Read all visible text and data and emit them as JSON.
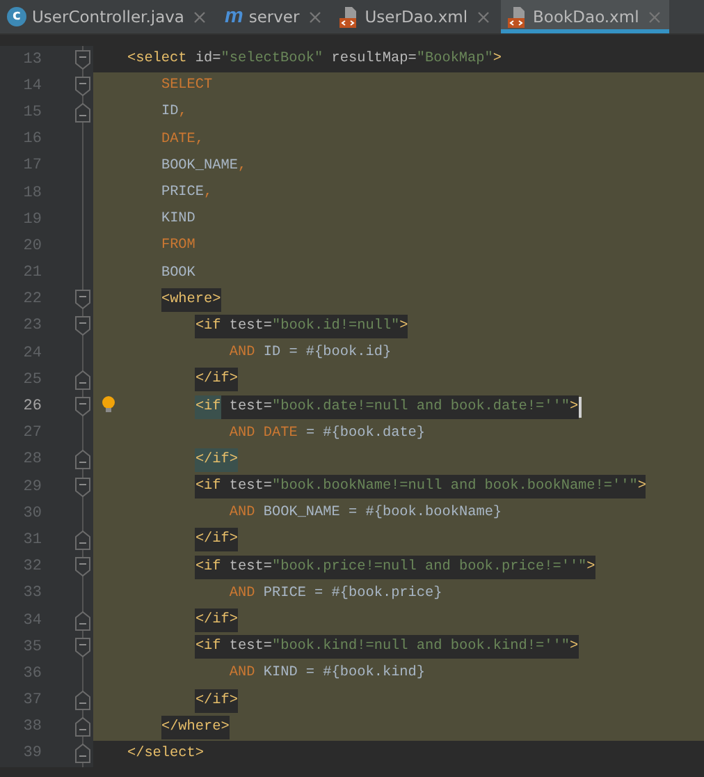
{
  "tabs": [
    {
      "label": "UserController.java",
      "kind": "class",
      "icon_text": "c",
      "selected": false
    },
    {
      "label": "server",
      "kind": "maven",
      "icon_text": "m",
      "selected": false
    },
    {
      "label": "UserDao.xml",
      "kind": "xml",
      "selected": false
    },
    {
      "label": "BookDao.xml",
      "kind": "xml",
      "selected": true
    }
  ],
  "editor": {
    "lines": [
      {
        "number": "13",
        "current": false,
        "hint": false,
        "sql": false,
        "fold_start": true,
        "fold_end": false,
        "tokens": [
          {
            "kind": "tag",
            "text": "<select",
            "matched": false
          },
          {
            "kind": "attr",
            "text": " id=",
            "matched": false
          },
          {
            "kind": "str",
            "text": "\"selectBook\"",
            "matched": false
          },
          {
            "kind": "attr",
            "text": " resultMap=",
            "matched": false
          },
          {
            "kind": "str",
            "text": "\"BookMap\"",
            "matched": false
          },
          {
            "kind": "tag",
            "text": ">",
            "matched": false
          }
        ],
        "children": [
          {
            "number": "14",
            "current": false,
            "hint": false,
            "sql": true,
            "fold_start": true,
            "fold_end": false,
            "tokens": [
              {
                "kind": "kw",
                "text": "SELECT",
                "matched": false
              }
            ]
          },
          {
            "number": "15",
            "current": false,
            "hint": false,
            "sql": true,
            "fold_start": false,
            "fold_end": true,
            "tokens": [
              {
                "kind": "text",
                "text": "ID",
                "matched": false
              },
              {
                "kind": "kw",
                "text": ",",
                "matched": false
              }
            ]
          },
          {
            "number": "16",
            "current": false,
            "hint": false,
            "sql": true,
            "fold_start": false,
            "fold_end": false,
            "tokens": [
              {
                "kind": "kw",
                "text": "DATE,",
                "matched": false
              }
            ]
          },
          {
            "number": "17",
            "current": false,
            "hint": false,
            "sql": true,
            "fold_start": false,
            "fold_end": false,
            "tokens": [
              {
                "kind": "text",
                "text": "BOOK_NAME",
                "matched": false
              },
              {
                "kind": "kw",
                "text": ",",
                "matched": false
              }
            ]
          },
          {
            "number": "18",
            "current": false,
            "hint": false,
            "sql": true,
            "fold_start": false,
            "fold_end": false,
            "tokens": [
              {
                "kind": "text",
                "text": "PRICE",
                "matched": false
              },
              {
                "kind": "kw",
                "text": ",",
                "matched": false
              }
            ]
          },
          {
            "number": "19",
            "current": false,
            "hint": false,
            "sql": true,
            "fold_start": false,
            "fold_end": false,
            "tokens": [
              {
                "kind": "text",
                "text": "KIND",
                "matched": false
              }
            ]
          },
          {
            "number": "20",
            "current": false,
            "hint": false,
            "sql": true,
            "fold_start": false,
            "fold_end": false,
            "tokens": [
              {
                "kind": "kw",
                "text": "FROM",
                "matched": false
              }
            ]
          },
          {
            "number": "21",
            "current": false,
            "hint": false,
            "sql": true,
            "fold_start": false,
            "fold_end": false,
            "tokens": [
              {
                "kind": "text",
                "text": "BOOK",
                "matched": false
              }
            ]
          },
          {
            "number": "22",
            "current": false,
            "hint": false,
            "sql": true,
            "fold_start": true,
            "fold_end": false,
            "tokens": [
              {
                "kind": "tag",
                "text": "<where>",
                "matched": false
              }
            ],
            "children": [
              {
                "number": "23",
                "current": false,
                "hint": false,
                "sql": true,
                "fold_start": true,
                "fold_end": false,
                "tokens": [
                  {
                    "kind": "tag",
                    "text": "<if",
                    "matched": false
                  },
                  {
                    "kind": "attr",
                    "text": " test=",
                    "matched": false
                  },
                  {
                    "kind": "str",
                    "text": "\"book.id!=null\"",
                    "matched": false
                  },
                  {
                    "kind": "tag",
                    "text": ">",
                    "matched": false
                  }
                ],
                "children": [
                  {
                    "number": "24",
                    "current": false,
                    "hint": false,
                    "sql": true,
                    "fold_start": false,
                    "fold_end": false,
                    "tokens": [
                      {
                        "kind": "kw",
                        "text": "AND",
                        "matched": false
                      },
                      {
                        "kind": "text",
                        "text": " ID = #{book.id}",
                        "matched": false
                      }
                    ]
                  }
                ]
              },
              {
                "number": "25",
                "current": false,
                "hint": false,
                "sql": true,
                "fold_start": false,
                "fold_end": true,
                "tokens": [
                  {
                    "kind": "tag",
                    "text": "</if>",
                    "matched": false
                  }
                ]
              },
              {
                "number": "26",
                "current": true,
                "hint": true,
                "sql": true,
                "fold_start": true,
                "fold_end": false,
                "tokens": [
                  {
                    "kind": "tag",
                    "text": "<if",
                    "matched": true
                  },
                  {
                    "kind": "attr",
                    "text": " test=",
                    "matched": false
                  },
                  {
                    "kind": "str",
                    "text": "\"book.date!=null and book.date!=''\"",
                    "matched": false
                  },
                  {
                    "kind": "tag",
                    "text": ">",
                    "matched": false
                  }
                ],
                "children": [
                  {
                    "number": "27",
                    "current": false,
                    "hint": false,
                    "sql": true,
                    "fold_start": false,
                    "fold_end": false,
                    "tokens": [
                      {
                        "kind": "kw",
                        "text": "AND DATE",
                        "matched": false
                      },
                      {
                        "kind": "text",
                        "text": " = #{book.date}",
                        "matched": false
                      }
                    ]
                  }
                ]
              },
              {
                "number": "28",
                "current": false,
                "hint": false,
                "sql": true,
                "fold_start": false,
                "fold_end": true,
                "tokens": [
                  {
                    "kind": "tag",
                    "text": "</if>",
                    "matched": true
                  }
                ]
              },
              {
                "number": "29",
                "current": false,
                "hint": false,
                "sql": true,
                "fold_start": true,
                "fold_end": false,
                "tokens": [
                  {
                    "kind": "tag",
                    "text": "<if",
                    "matched": false
                  },
                  {
                    "kind": "attr",
                    "text": " test=",
                    "matched": false
                  },
                  {
                    "kind": "str",
                    "text": "\"book.bookName!=null and book.bookName!=''\"",
                    "matched": false
                  },
                  {
                    "kind": "tag",
                    "text": ">",
                    "matched": false
                  }
                ],
                "children": [
                  {
                    "number": "30",
                    "current": false,
                    "hint": false,
                    "sql": true,
                    "fold_start": false,
                    "fold_end": false,
                    "tokens": [
                      {
                        "kind": "kw",
                        "text": "AND",
                        "matched": false
                      },
                      {
                        "kind": "text",
                        "text": " BOOK_NAME = #{book.bookName}",
                        "matched": false
                      }
                    ]
                  }
                ]
              },
              {
                "number": "31",
                "current": false,
                "hint": false,
                "sql": true,
                "fold_start": false,
                "fold_end": true,
                "tokens": [
                  {
                    "kind": "tag",
                    "text": "</if>",
                    "matched": false
                  }
                ]
              },
              {
                "number": "32",
                "current": false,
                "hint": false,
                "sql": true,
                "fold_start": true,
                "fold_end": false,
                "tokens": [
                  {
                    "kind": "tag",
                    "text": "<if",
                    "matched": false
                  },
                  {
                    "kind": "attr",
                    "text": " test=",
                    "matched": false
                  },
                  {
                    "kind": "str",
                    "text": "\"book.price!=null and book.price!=''\"",
                    "matched": false
                  },
                  {
                    "kind": "tag",
                    "text": ">",
                    "matched": false
                  }
                ],
                "children": [
                  {
                    "number": "33",
                    "current": false,
                    "hint": false,
                    "sql": true,
                    "fold_start": false,
                    "fold_end": false,
                    "tokens": [
                      {
                        "kind": "kw",
                        "text": "AND",
                        "matched": false
                      },
                      {
                        "kind": "text",
                        "text": " PRICE = #{book.price}",
                        "matched": false
                      }
                    ]
                  }
                ]
              },
              {
                "number": "34",
                "current": false,
                "hint": false,
                "sql": true,
                "fold_start": false,
                "fold_end": true,
                "tokens": [
                  {
                    "kind": "tag",
                    "text": "</if>",
                    "matched": false
                  }
                ]
              },
              {
                "number": "35",
                "current": false,
                "hint": false,
                "sql": true,
                "fold_start": true,
                "fold_end": false,
                "tokens": [
                  {
                    "kind": "tag",
                    "text": "<if",
                    "matched": false
                  },
                  {
                    "kind": "attr",
                    "text": " test=",
                    "matched": false
                  },
                  {
                    "kind": "str",
                    "text": "\"book.kind!=null and book.kind!=''\"",
                    "matched": false
                  },
                  {
                    "kind": "tag",
                    "text": ">",
                    "matched": false
                  }
                ],
                "children": [
                  {
                    "number": "36",
                    "current": false,
                    "hint": false,
                    "sql": true,
                    "fold_start": false,
                    "fold_end": false,
                    "tokens": [
                      {
                        "kind": "kw",
                        "text": "AND",
                        "matched": false
                      },
                      {
                        "kind": "text",
                        "text": " KIND = #{book.kind}",
                        "matched": false
                      }
                    ]
                  }
                ]
              },
              {
                "number": "37",
                "current": false,
                "hint": false,
                "sql": true,
                "fold_start": false,
                "fold_end": true,
                "tokens": [
                  {
                    "kind": "tag",
                    "text": "</if>",
                    "matched": false
                  }
                ]
              }
            ]
          },
          {
            "number": "38",
            "current": false,
            "hint": false,
            "sql": true,
            "fold_start": false,
            "fold_end": true,
            "tokens": [
              {
                "kind": "tag",
                "text": "</where>",
                "matched": false
              }
            ]
          }
        ]
      },
      {
        "number": "39",
        "current": false,
        "hint": false,
        "sql": false,
        "fold_start": false,
        "fold_end": true,
        "tokens": [
          {
            "kind": "tag",
            "text": "</select>",
            "matched": false
          }
        ]
      }
    ]
  }
}
